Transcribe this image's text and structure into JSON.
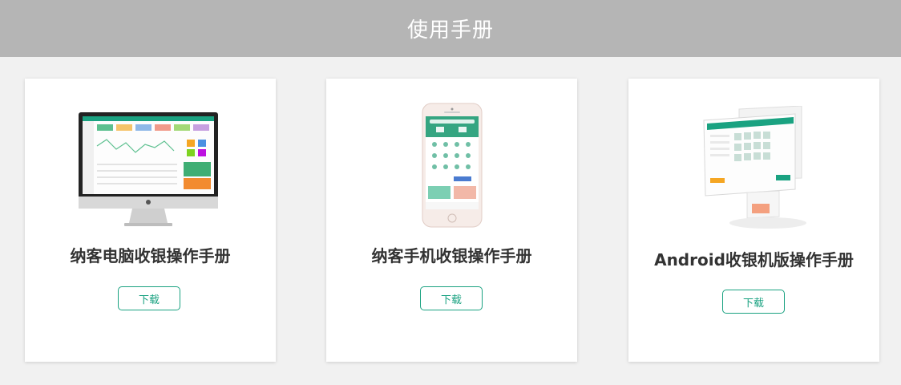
{
  "header": {
    "title": "使用手册"
  },
  "colors": {
    "header_bg": "#b5b5b5",
    "accent": "#1aa281",
    "page_bg": "#f1f1f1"
  },
  "cards": [
    {
      "title": "纳客电脑收银操作手册",
      "button_label": "下载",
      "image": "desktop-monitor-illustration"
    },
    {
      "title": "纳客手机收银操作手册",
      "button_label": "下载",
      "image": "smartphone-illustration"
    },
    {
      "title": "Android收银机版操作手册",
      "button_label": "下载",
      "image": "pos-terminal-illustration"
    }
  ]
}
